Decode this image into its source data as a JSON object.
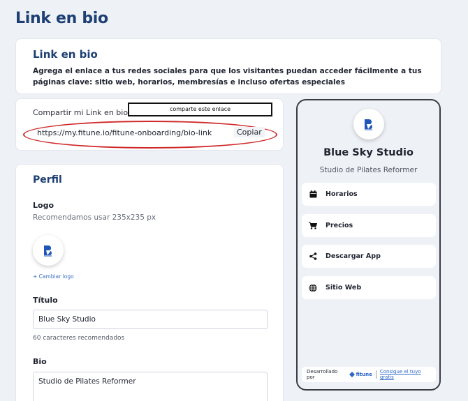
{
  "page": {
    "title": "Link en bio"
  },
  "intro": {
    "title": "Link en bio",
    "description": "Agrega el enlace a tus redes sociales para que los visitantes puedan acceder fácilmente a tus páginas clave: sitio web, horarios, membresías e incluso ofertas especiales"
  },
  "share": {
    "label": "Compartir mi Link en bio",
    "callout": "comparte este enlace",
    "url": "https://my.fitune.io/fitune-onboarding/bio-link",
    "copy_label": "Copiar",
    "highlight_color": "#cf2a2a"
  },
  "profile": {
    "title": "Perfil",
    "logo_label": "Logo",
    "logo_hint": "Recomendamos usar 235x235 px",
    "change_logo": "+ Cambiar logo",
    "title_label": "Título",
    "title_value": "Blue Sky Studio",
    "title_hint": "60 caracteres recomendados",
    "bio_label": "Bio",
    "bio_value": "Studio de Pilates Reformer"
  },
  "preview": {
    "studio_name": "Blue Sky Studio",
    "subtitle": "Studio de Pilates Reformer",
    "items": [
      {
        "label": "Horarios",
        "icon": "calendar-icon"
      },
      {
        "label": "Precios",
        "icon": "cart-icon"
      },
      {
        "label": "Descargar App",
        "icon": "share-icon"
      },
      {
        "label": "Sitio Web",
        "icon": "globe-icon"
      }
    ],
    "footer_prefix": "Desarrollado por",
    "footer_brand": "fitune",
    "footer_cta": "Consigue el tuyo gratis"
  },
  "colors": {
    "accent": "#1d3f73",
    "brand_blue": "#2a66c7",
    "background": "#eef1f6"
  }
}
